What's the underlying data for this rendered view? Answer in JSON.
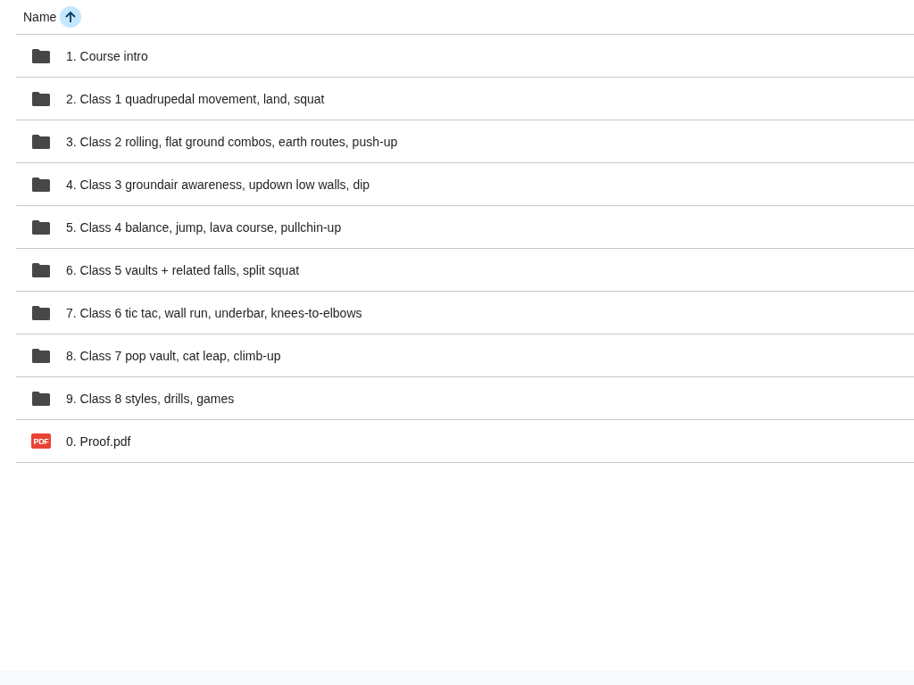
{
  "header": {
    "column": "Name"
  },
  "files": [
    {
      "kind": "folder",
      "name": "1. Course intro"
    },
    {
      "kind": "folder",
      "name": "2. Class 1 quadrupedal movement, land, squat"
    },
    {
      "kind": "folder",
      "name": "3. Class 2 rolling, flat ground combos, earth routes, push-up"
    },
    {
      "kind": "folder",
      "name": "4. Class 3 groundair awareness, updown low walls, dip"
    },
    {
      "kind": "folder",
      "name": "5. Class 4 balance, jump, lava course, pullchin-up"
    },
    {
      "kind": "folder",
      "name": "6. Class 5 vaults + related falls, split squat"
    },
    {
      "kind": "folder",
      "name": "7. Class 6 tic tac, wall run, underbar, knees-to-elbows"
    },
    {
      "kind": "folder",
      "name": "8. Class 7 pop vault, cat leap, climb-up"
    },
    {
      "kind": "folder",
      "name": "9. Class 8 styles, drills, games"
    },
    {
      "kind": "pdf",
      "name": "0. Proof.pdf",
      "badge": "PDF"
    }
  ]
}
